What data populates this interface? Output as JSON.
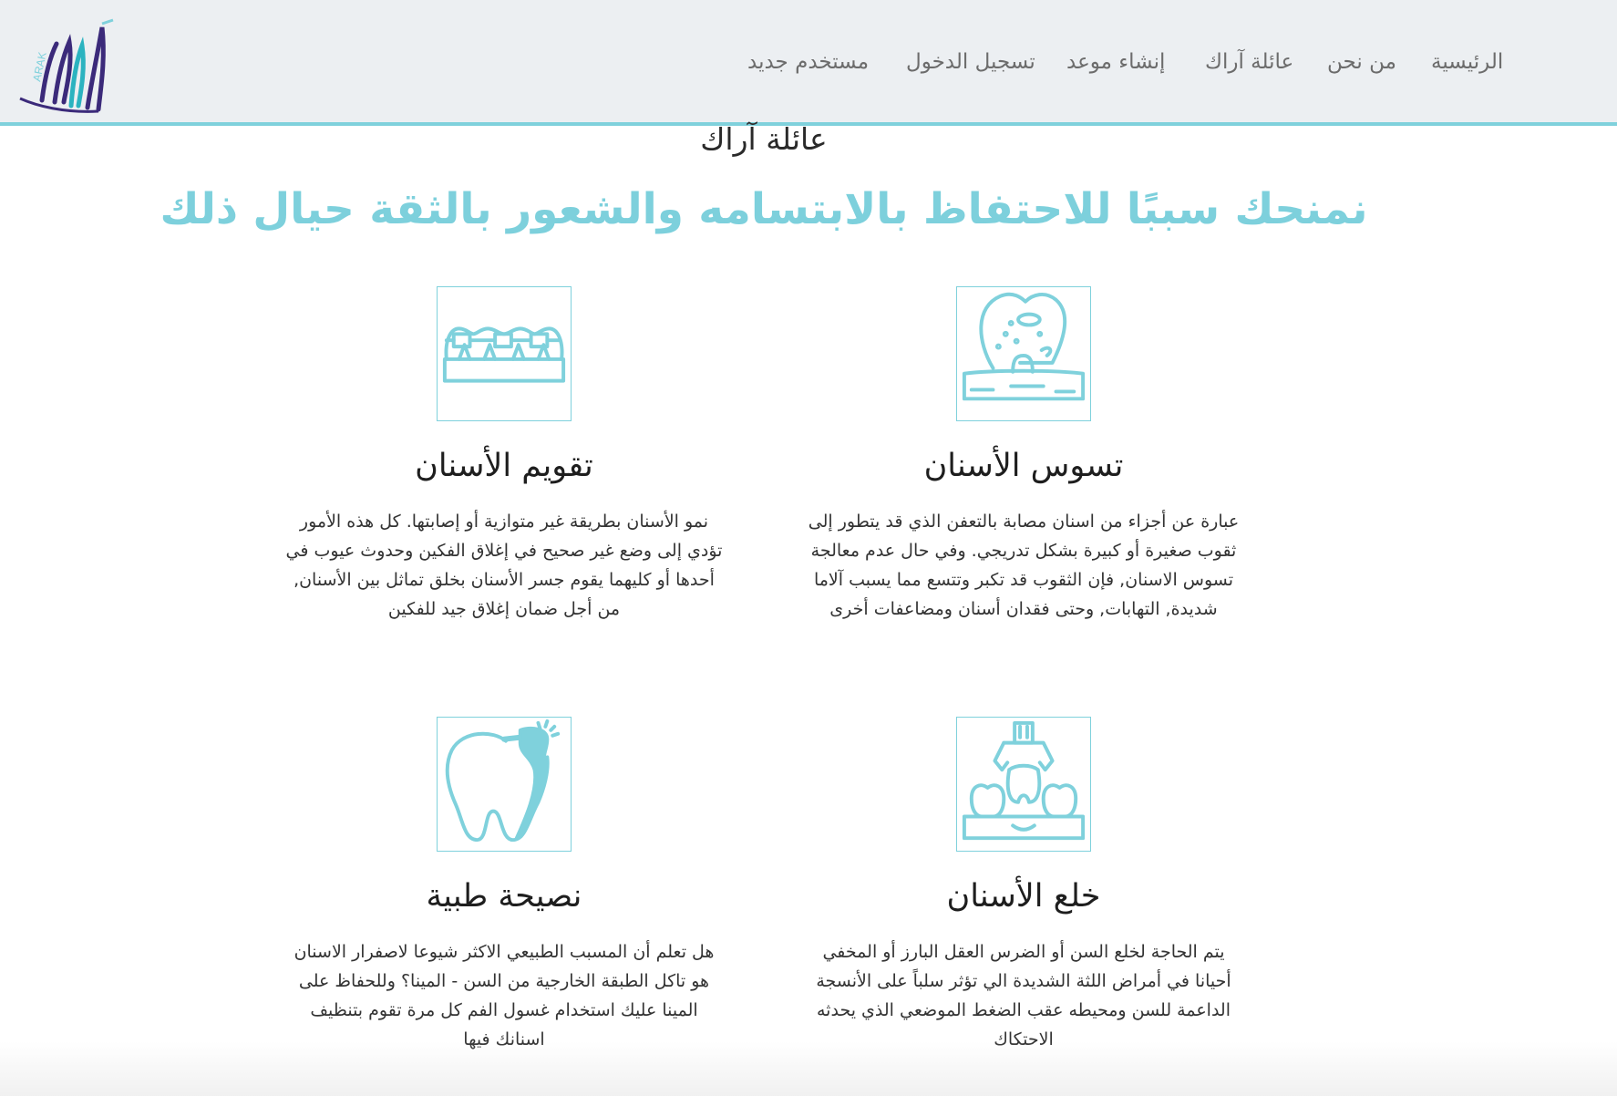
{
  "brand": {
    "logo_text": "ARAK",
    "accent_color": "#7fd1dc",
    "logo_color": "#3b2a7a"
  },
  "nav": {
    "items": [
      {
        "label": "الرئيسية"
      },
      {
        "label": "من نحن"
      },
      {
        "label": "عائلة آراك"
      },
      {
        "label": "إنشاء موعد"
      },
      {
        "label": "تسجيل الدخول"
      },
      {
        "label": "مستخدم جديد"
      }
    ]
  },
  "section": {
    "title": "عائلة آراك",
    "tagline": "نمنحك سببًا للاحتفاظ بالابتسامه والشعور بالثقة حيال ذلك"
  },
  "cards": [
    {
      "icon": "tooth-decay-icon",
      "title": "تسوس الأسنان",
      "text": "عبارة عن أجزاء من اسنان مصابة بالتعفن الذي قد يتطور إلى ثقوب صغيرة أو كبيرة بشكل تدريجي. وفي حال عدم معالجة تسوس الاسنان, فإن الثقوب قد تكبر وتتسع مما يسبب آلاما شديدة, التهابات, وحتى فقدان أسنان ومضاعفات أخرى"
    },
    {
      "icon": "braces-icon",
      "title": "تقويم الأسنان",
      "text": "نمو الأسنان بطريقة غير متوازية أو إصابتها. كل هذه الأمور تؤدي إلى وضع غير صحيح في إغلاق الفكين وحدوث عيوب في أحدها أو كليهما يقوم جسر الأسنان بخلق تماثل بين الأسنان, من أجل ضمان إغلاق جيد للفكين"
    },
    {
      "icon": "tooth-extraction-icon",
      "title": "خلع الأسنان",
      "text": "يتم الحاجة لخلع السن أو الضرس العقل البارز أو المخفي أحيانا في أمراض اللثة الشديدة الي تؤثر سلباً على الأنسجة الداعمة للسن ومحيطه عقب الضغط الموضعي الذي يحدثه الاحتكاك"
    },
    {
      "icon": "tooth-whitening-icon",
      "title": "نصيحة طبية",
      "text": "هل تعلم أن المسبب الطبيعي الاكثر شيوعا لاصفرار الاسنان هو تاكل الطبقة الخارجية من السن - المينا؟ وللحفاظ على المينا عليك استخدام غسول الفم كل مرة تقوم بتنظيف اسنانك فيها"
    }
  ]
}
